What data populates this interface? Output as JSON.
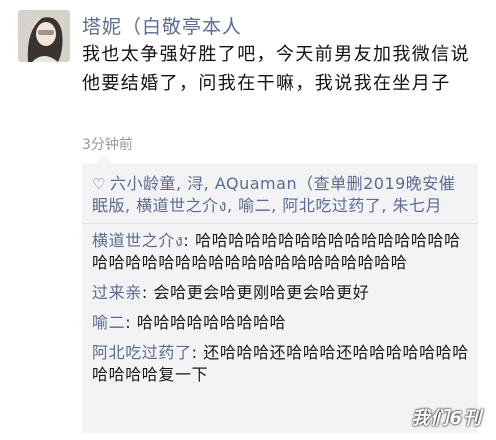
{
  "post": {
    "author": "塔妮（白敬亭本人",
    "content": "我也太争强好胜了吧，今天前男友加我微信说他要结婚了，问我在干嘛，我说我在坐月子",
    "time": "3分钟前",
    "avatar_icon": "user-avatar-photo"
  },
  "likes": {
    "icon": "heart-icon",
    "names": "六小龄童, 浔, AQuaman（查单删2019晚安催眠版, 横道世之介ง, 喻二, 阿北吃过药了, 朱七月"
  },
  "comments": [
    {
      "name": "横道世之介ง",
      "text": ": 哈哈哈哈哈哈哈哈哈哈哈哈哈哈哈哈哈哈哈哈哈哈哈哈哈哈哈哈哈哈哈哈哈哈哈"
    },
    {
      "name": "过来亲",
      "text": ": 会哈更会哈更刚哈更会哈更好"
    },
    {
      "name": "喻二",
      "text": ": 哈哈哈哈哈哈哈哈哈"
    },
    {
      "name": "阿北吃过药了",
      "text": ": 还哈哈哈还哈哈哈还哈哈哈哈哈哈哈哈哈哈哈复一下"
    }
  ],
  "watermark": "我们6刊",
  "colors": {
    "name_link": "#5a6b94",
    "comment_bg": "#f3f3f5",
    "time": "#9a9a9a"
  }
}
